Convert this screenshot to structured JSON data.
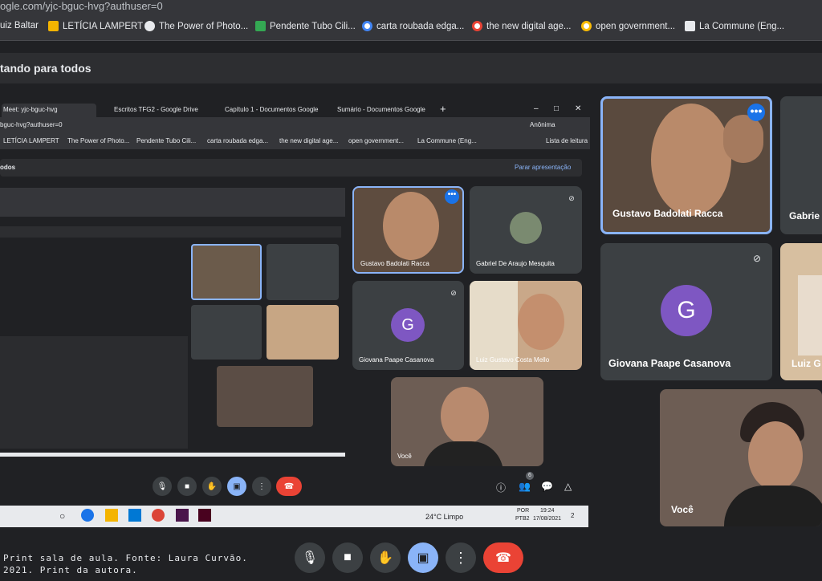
{
  "browser": {
    "url": "ogle.com/yjc-bguc-hvg?authuser=0",
    "bookmarks": [
      {
        "label": "uiz Baltar"
      },
      {
        "label": "LETÍCIA LAMPERT"
      },
      {
        "label": "The Power of Photo..."
      },
      {
        "label": "Pendente Tubo Cili..."
      },
      {
        "label": "carta roubada edga..."
      },
      {
        "label": "the new digital age..."
      },
      {
        "label": "open government..."
      },
      {
        "label": "La Commune (Eng..."
      }
    ]
  },
  "meet": {
    "presenting_banner": "tando para todos",
    "participants": {
      "gustavo": "Gustavo Badolati Racca",
      "gabriel_partial": "Gabrie",
      "giovana": "Giovana Paape Casanova",
      "luiz_partial": "Luiz G",
      "voce": "Você"
    },
    "avatar_letter": "G",
    "controls": [
      "mic",
      "camera",
      "raise-hand",
      "present",
      "more",
      "leave"
    ]
  },
  "shared_screen": {
    "tabs": [
      "Meet: yjc-bguc-hvg",
      "Escritos TFG2 - Google Drive",
      "Capítulo 1 - Documentos Google",
      "Sumário - Documentos Google"
    ],
    "url": "bguc-hvg?authuser=0",
    "profile_label": "Anônima",
    "bookmarks": [
      "LETÍCIA LAMPERT",
      "The Power of Photo...",
      "Pendente Tubo Cili...",
      "carta roubada edga...",
      "the new digital age...",
      "open government...",
      "La Commune (Eng...",
      "Lista de leitura"
    ],
    "presenting_label": "odos",
    "stop_presenting": "Parar apresentação",
    "tiles": {
      "gustavo": "Gustavo Badolati Racca",
      "gabriel": "Gabriel De Araujo Mesquita",
      "giovana": "Giovana Paape Casanova",
      "luiz": "Luiz Gustavo Costa Mello",
      "voce": "Você"
    },
    "participant_count": "6",
    "taskbar": {
      "weather": "24°C  Limpo",
      "lang": "POR",
      "layout": "PTB2",
      "time": "19:24",
      "date": "17/08/2021",
      "notifications": "2"
    }
  },
  "caption": {
    "line1": "Print sala de aula. Fonte: Laura Curvão.",
    "line2": "2021. Print da autora."
  }
}
